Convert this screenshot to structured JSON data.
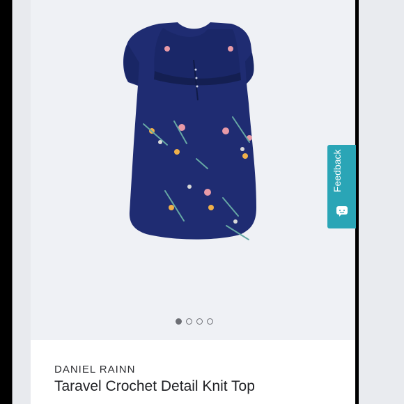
{
  "product": {
    "brand": "DANIEL RAINN",
    "title": "Taravel Crochet Detail Knit Top",
    "image_icon": "floral-knit-top-image"
  },
  "gallery": {
    "pages_total": 4,
    "current_page": 1
  },
  "feedback": {
    "label": "Feedback",
    "icon": "chat-bubble-icon",
    "color": "#2aa5b6"
  },
  "colors": {
    "gallery_bg": "#eff1f5",
    "shirt_navy": "#1f2c72"
  }
}
